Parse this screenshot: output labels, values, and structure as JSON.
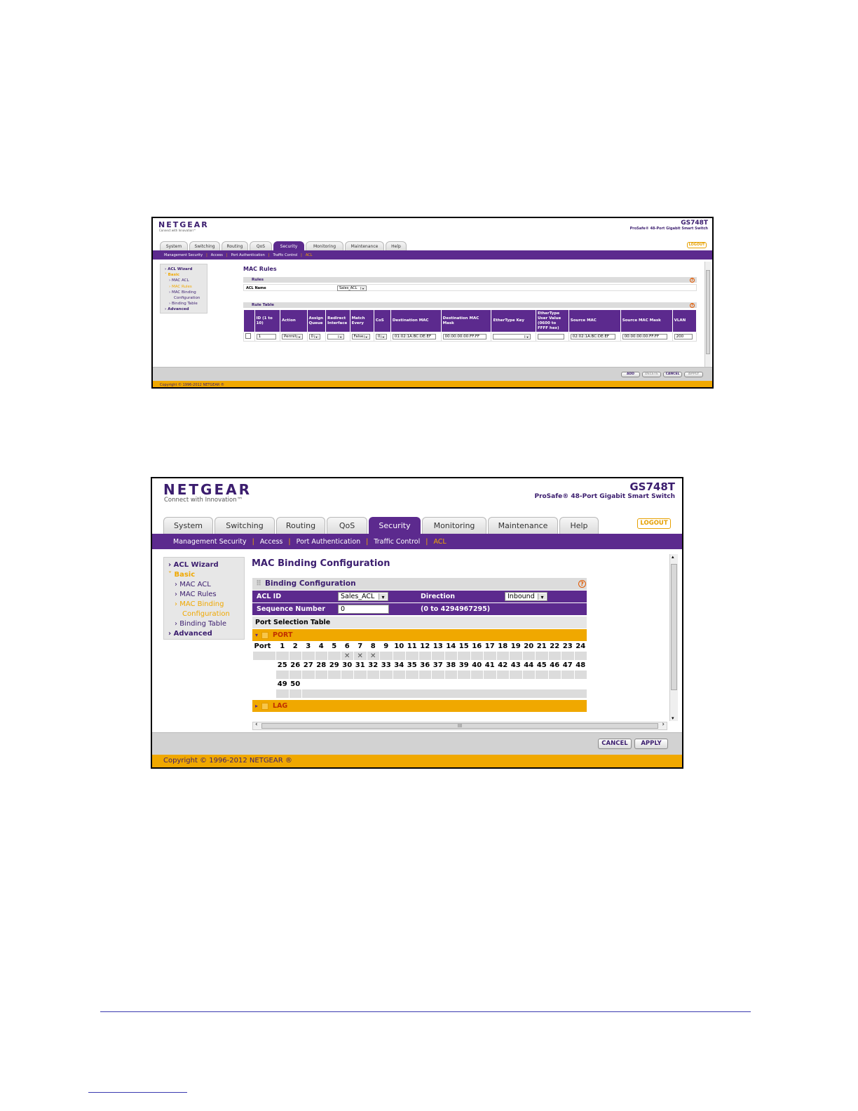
{
  "brand": {
    "logo": "NETGEAR",
    "tagline": "Connect with Innovation™",
    "model": "GS748T",
    "description": "ProSafe® 48-Port Gigabit Smart Switch"
  },
  "tabs": [
    "System",
    "Switching",
    "Routing",
    "QoS",
    "Security",
    "Monitoring",
    "Maintenance",
    "Help"
  ],
  "logout": "LOGOUT",
  "subnav": [
    "Management Security",
    "Access",
    "Port Authentication",
    "Traffic Control",
    "ACL"
  ],
  "sidebar": {
    "acl_wizard": "ACL Wizard",
    "basic": "Basic",
    "mac_acl": "MAC ACL",
    "mac_rules": "MAC Rules",
    "mac_binding": "MAC Binding",
    "configuration": "Configuration",
    "binding_table": "Binding Table",
    "advanced": "Advanced"
  },
  "copyright": "Copyright © 1996-2012 NETGEAR ®",
  "shot1": {
    "page_title": "MAC Rules",
    "rules_section": "Rules",
    "acl_name_label": "ACL Name",
    "acl_name_value": "Sales_ACL",
    "rule_table_section": "Rule Table",
    "columns": [
      "ID (1 to 10)",
      "Action",
      "Assign Queue",
      "Redirect Interface",
      "Match Every",
      "CoS",
      "Destination MAC",
      "Destination MAC Mask",
      "EtherType Key",
      "EtherType User Value (0600 to FFFF hex)",
      "Source MAC",
      "Source MAC Mask",
      "VLAN"
    ],
    "row": {
      "id": "1",
      "action": "Permit",
      "assign_queue": "0",
      "redirect_interface": "",
      "match_every": "False",
      "cos": "0",
      "dest_mac": "01:02:1A:BC:DE:EF",
      "dest_mac_mask": "00:00:00:00:FF:FF",
      "ethertype_key": "",
      "ethertype_value": "",
      "source_mac": "02:02:1A:BC:DE:EF",
      "source_mac_mask": "00:00:00:00:FF:FF",
      "vlan": "200"
    },
    "buttons": {
      "add": "ADD",
      "delete": "DELETE",
      "cancel": "CANCEL",
      "apply": "APPLY"
    }
  },
  "shot2": {
    "page_title": "MAC Binding Configuration",
    "section": "Binding Configuration",
    "acl_id_label": "ACL ID",
    "acl_id_value": "Sales_ACL",
    "direction_label": "Direction",
    "direction_value": "Inbound",
    "seq_label": "Sequence Number",
    "seq_value": "0",
    "seq_range": "(0 to 4294967295)",
    "port_sel_table": "Port Selection Table",
    "port_group": "PORT",
    "lag_group": "LAG",
    "port_label": "Port",
    "ports_row1": [
      "1",
      "2",
      "3",
      "4",
      "5",
      "6",
      "7",
      "8",
      "9",
      "10",
      "11",
      "12",
      "13",
      "14",
      "15",
      "16",
      "17",
      "18",
      "19",
      "20",
      "21",
      "22",
      "23",
      "24"
    ],
    "ports_row2": [
      "25",
      "26",
      "27",
      "28",
      "29",
      "30",
      "31",
      "32",
      "33",
      "34",
      "35",
      "36",
      "37",
      "38",
      "39",
      "40",
      "41",
      "42",
      "43",
      "44",
      "45",
      "46",
      "47",
      "48"
    ],
    "ports_row3": [
      "49",
      "50"
    ],
    "selected_ports": [
      "6",
      "7",
      "8"
    ],
    "hscroll_label": "III",
    "buttons": {
      "cancel": "CANCEL",
      "apply": "APPLY"
    }
  }
}
